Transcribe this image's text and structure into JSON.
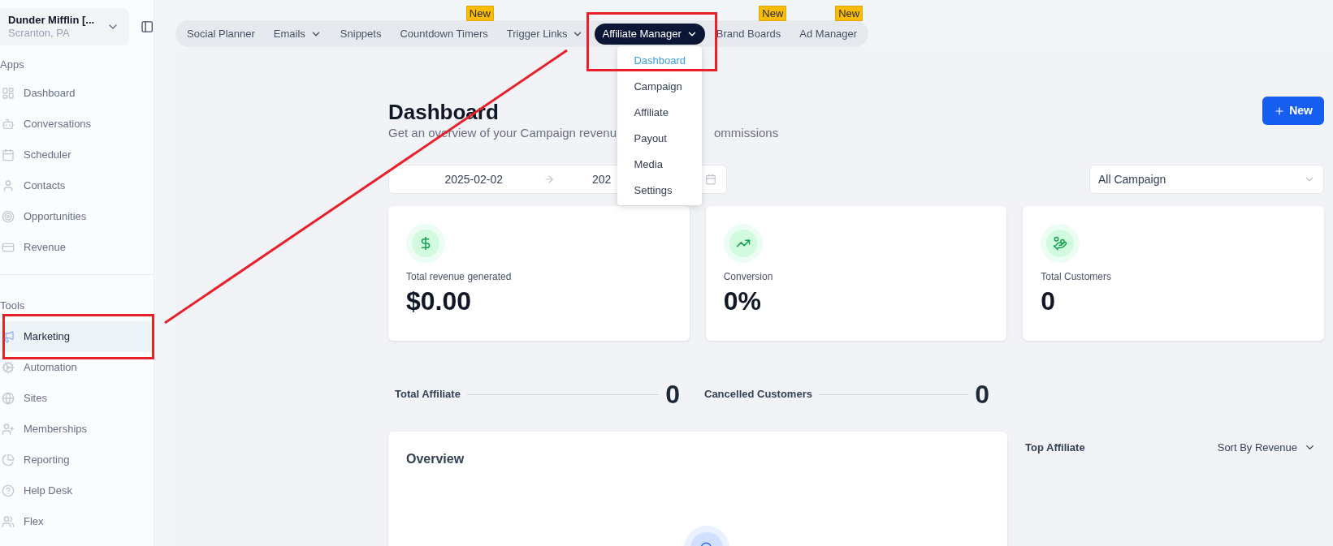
{
  "account": {
    "name": "Dunder Mifflin [...",
    "location": "Scranton, PA"
  },
  "sidebar": [
    {
      "title": "Apps",
      "items": [
        {
          "label": "Dashboard",
          "selected": false
        },
        {
          "label": "Conversations",
          "selected": false
        },
        {
          "label": "Scheduler",
          "selected": false
        },
        {
          "label": "Contacts",
          "selected": false
        },
        {
          "label": "Opportunities",
          "selected": false
        },
        {
          "label": "Revenue",
          "selected": false
        }
      ]
    },
    {
      "title": "Tools",
      "items": [
        {
          "label": "Marketing",
          "selected": true
        },
        {
          "label": "Automation",
          "selected": false
        },
        {
          "label": "Sites",
          "selected": false
        },
        {
          "label": "Memberships",
          "selected": false
        },
        {
          "label": "Reporting",
          "selected": false
        },
        {
          "label": "Help Desk",
          "selected": false
        },
        {
          "label": "Flex",
          "selected": false
        }
      ]
    }
  ],
  "top_nav": [
    {
      "label": "Social Planner",
      "has_menu": false,
      "selected": false
    },
    {
      "label": "Emails",
      "has_menu": true,
      "selected": false
    },
    {
      "label": "Snippets",
      "has_menu": false,
      "selected": false
    },
    {
      "label": "Countdown Timers",
      "has_menu": false,
      "selected": false,
      "badge": "New"
    },
    {
      "label": "Trigger Links",
      "has_menu": true,
      "selected": false
    },
    {
      "label": "Affiliate Manager",
      "has_menu": true,
      "selected": true
    },
    {
      "label": "Brand Boards",
      "has_menu": false,
      "selected": false,
      "badge": "New"
    },
    {
      "label": "Ad Manager",
      "has_menu": false,
      "selected": false,
      "badge": "New"
    }
  ],
  "dropdown": [
    {
      "label": "Dashboard",
      "selected": true
    },
    {
      "label": "Campaign",
      "selected": false
    },
    {
      "label": "Affiliate",
      "selected": false
    },
    {
      "label": "Payout",
      "selected": false
    },
    {
      "label": "Media",
      "selected": false
    },
    {
      "label": "Settings",
      "selected": false
    }
  ],
  "page": {
    "title": "Dashboard",
    "subtitle_parts": [
      "Get an overview of your Campaign revenu",
      "ommissions"
    ],
    "new_button": "New"
  },
  "date_range": {
    "start": "2025-02-02",
    "end": "202"
  },
  "campaign_select": "All Campaign",
  "cards": [
    {
      "kind": "revenue",
      "label": "Total revenue generated",
      "value": "$0.00"
    },
    {
      "kind": "conversion",
      "label": "Conversion",
      "value": "0%"
    },
    {
      "kind": "customers",
      "label": "Total Customers",
      "value": "0"
    }
  ],
  "stats": [
    {
      "label": "Total Affiliate",
      "value": "0"
    },
    {
      "label": "Cancelled Customers",
      "value": "0"
    }
  ],
  "overview": {
    "title": "Overview"
  },
  "top_affiliate": {
    "title": "Top Affiliate",
    "sort": "Sort By Revenue"
  }
}
